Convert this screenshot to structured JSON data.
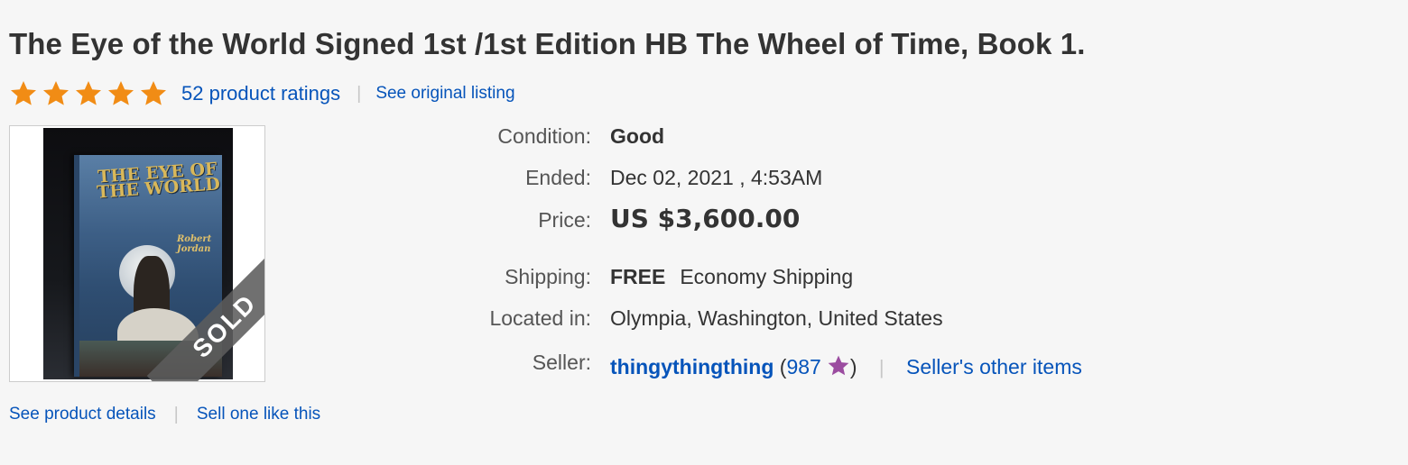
{
  "title": "The Eye of the World Signed 1st /1st Edition HB The Wheel of Time, Book 1.",
  "rating": {
    "stars": 5,
    "star_color": "#f18c15",
    "ratings_link": "52 product ratings",
    "original_listing_link": "See original listing"
  },
  "image": {
    "book_title": "THE EYE OF THE WORLD",
    "book_author": "Robert Jordan",
    "sold_label": "SOLD"
  },
  "image_links": {
    "product_details": "See product details",
    "sell_one": "Sell one like this"
  },
  "details": {
    "condition_label": "Condition:",
    "condition_value": "Good",
    "ended_label": "Ended:",
    "ended_value": "Dec 02, 2021 , 4:53AM",
    "price_label": "Price:",
    "price_value": "US $3,600.00",
    "shipping_label": "Shipping:",
    "shipping_free": "FREE",
    "shipping_method": "Economy Shipping",
    "location_label": "Located in:",
    "location_value": "Olympia, Washington, United States",
    "seller_label": "Seller:",
    "seller_name": "thingythingthing",
    "seller_paren_open": "(",
    "seller_feedback": "987",
    "seller_paren_close": ")",
    "feedback_star_color": "#9b4ca0",
    "seller_other_items": "Seller's other items"
  },
  "colors": {
    "link": "#0654ba",
    "background": "#f6f6f6"
  }
}
